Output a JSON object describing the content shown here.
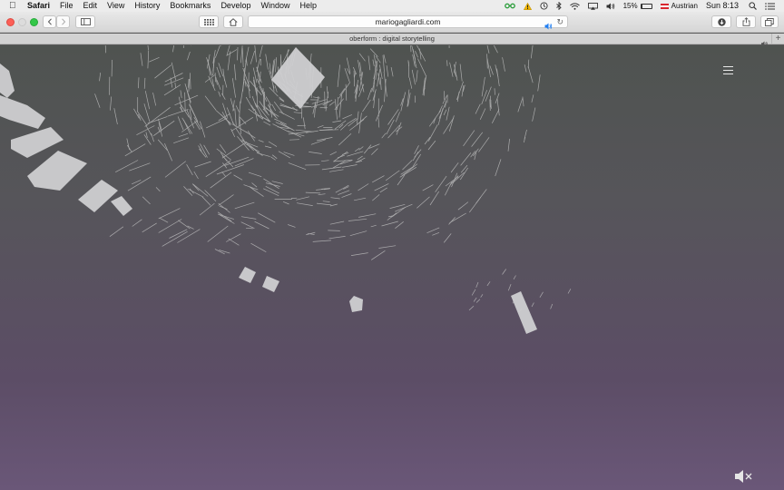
{
  "menubar": {
    "app_name": "Safari",
    "items": [
      "File",
      "Edit",
      "View",
      "History",
      "Bookmarks",
      "Develop",
      "Window",
      "Help"
    ],
    "battery": "15%",
    "input_source": "Austrian",
    "clock": "Sun 8:13"
  },
  "browser": {
    "url": "mariogagliardi.com",
    "tab_title": "oberform : digital storytelling",
    "new_tab": "+"
  },
  "colors": {
    "close": "#fc5f57",
    "maximize": "#33c748",
    "page_top": "#4f5350",
    "page_bottom": "#6a5778",
    "shape_fill": "#cfcfd1"
  },
  "icons": {
    "menu": "hamburger-icon",
    "sound": "muted-speaker-icon"
  }
}
